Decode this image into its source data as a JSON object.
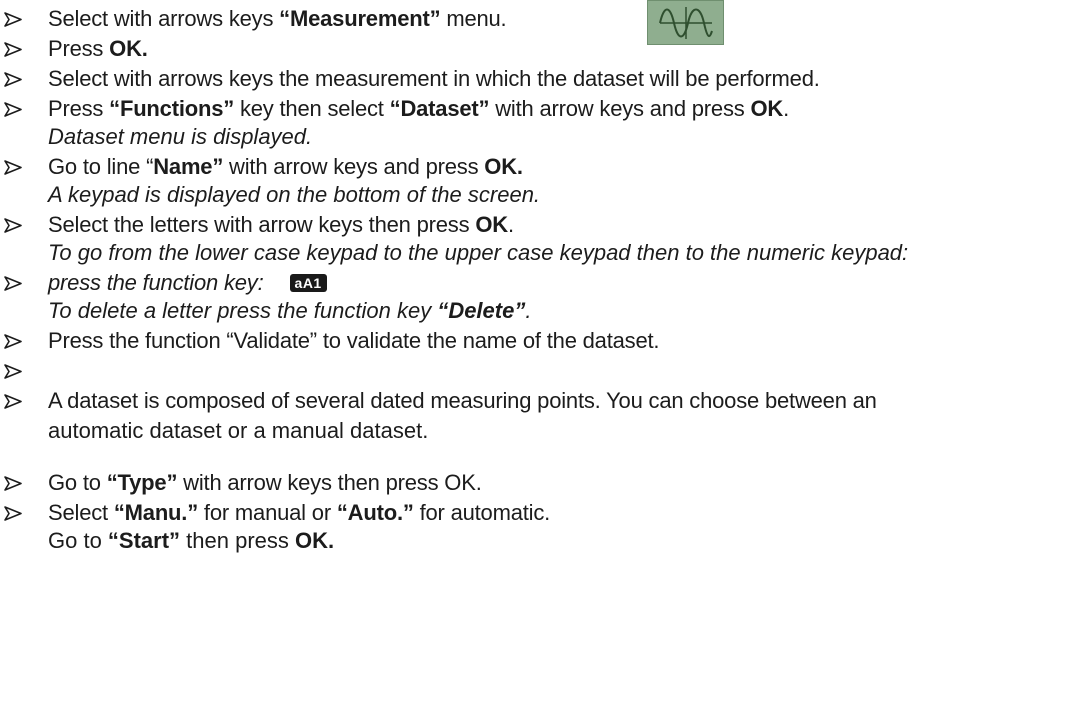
{
  "lines": [
    {
      "pre": "Select with arrows keys ",
      "bold": "“Measurement”",
      "post": " menu."
    },
    {
      "pre": "Press ",
      "bold": "OK."
    },
    {
      "text": "Select with arrows keys the measurement in which the dataset will be performed."
    },
    {
      "pre": "Press ",
      "b1": "“Functions”",
      "mid": " key then select ",
      "b2": "“Dataset”",
      "post": " with arrow keys and press ",
      "b3": "OK",
      "end": "."
    },
    {
      "italic": "Dataset menu is displayed."
    },
    {
      "pre": "Go to line “",
      "bold": "Name”",
      "post": " with arrow keys and press ",
      "b2": "OK."
    },
    {
      "italic": "A keypad is displayed on the bottom of the screen."
    },
    {
      "pre": "Select the letters with arrow keys then press ",
      "bold": "OK",
      "post": "."
    },
    {
      "italic": "To go from the lower case keypad to the upper case keypad then to the numeric keypad:"
    },
    {
      "italic": "press the function key:",
      "key": "aA1"
    },
    {
      "italic": "To delete a letter press the function key ",
      "bold": "“Delete”",
      "post": "."
    },
    {
      "text": "Press the function “Validate” to validate the name of the dataset."
    },
    {
      "text": ""
    },
    {
      "text": "A dataset is composed of several dated measuring points. You can choose between an",
      "cont": "automatic dataset or a manual dataset."
    },
    {
      "pre": "Go to ",
      "bold": "“Type”",
      "post": " with arrow keys then press OK."
    },
    {
      "pre": "Select ",
      "b1": "“Manu.”",
      "mid": " for manual or ",
      "b2": "“Auto.”",
      "post": " for automatic."
    },
    {
      "pre": "Go to ",
      "bold": "“Start”",
      "post": " then press ",
      "b2": "OK."
    }
  ],
  "icons": {
    "bullet": "arrow-bullet-icon",
    "measurement": "measurement-waveform-icon"
  },
  "colors": {
    "text": "#1c1c1c",
    "icon_bg": "#8fae8f",
    "key_bg": "#1a1a1a"
  }
}
